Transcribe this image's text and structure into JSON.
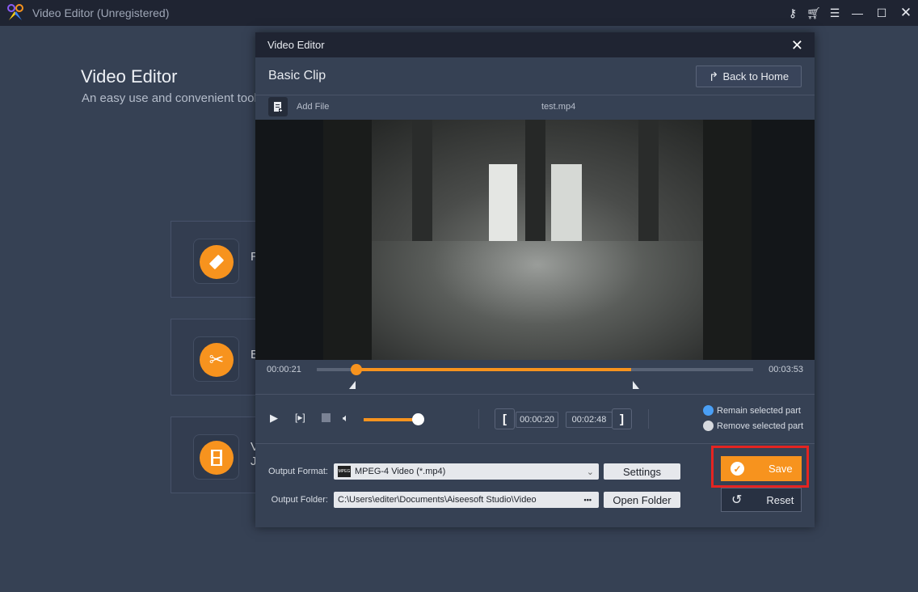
{
  "app": {
    "title": "Video Editor (Unregistered)"
  },
  "titlebar_icons": [
    "key-icon",
    "cart-icon",
    "menu-icon",
    "minimize-icon",
    "maximize-icon",
    "close-icon"
  ],
  "home": {
    "title": "Video Editor",
    "subtitle": "An easy use and convenient tool",
    "features": [
      {
        "icon": "rotate-icon",
        "label_partial": "R"
      },
      {
        "icon": "scissors-icon",
        "label_partial": "E"
      },
      {
        "icon": "film-icon",
        "label_partial_line1": "V",
        "label_partial_line2": "J"
      }
    ]
  },
  "dialog": {
    "title": "Video Editor",
    "heading": "Basic Clip",
    "back_button": "Back to Home",
    "add_file": "Add File",
    "filename": "test.mp4",
    "timeline": {
      "current_time": "00:00:21",
      "total_time": "00:03:53",
      "playhead_fraction": 0.09,
      "selection_end_fraction": 0.72
    },
    "controls": {
      "volume_fraction": 1.0,
      "start_time": "00:00:20",
      "end_time": "00:02:48",
      "start_bracket": "[",
      "end_bracket": "]"
    },
    "mode_options": [
      {
        "label": "Remain selected part",
        "selected": true
      },
      {
        "label": "Remove selected part",
        "selected": false
      }
    ],
    "output_format_label": "Output Format:",
    "output_format_value": "MPEG-4 Video (*.mp4)",
    "settings_button": "Settings",
    "output_folder_label": "Output Folder:",
    "output_folder_value": "C:\\Users\\editer\\Documents\\Aiseesoft Studio\\Video",
    "browse_glyph": "•••",
    "open_folder_button": "Open Folder",
    "save_button": "Save",
    "reset_button": "Reset"
  },
  "colors": {
    "accent": "#f7931e",
    "highlight": "#e52421",
    "radio_on": "#4a9ff5"
  }
}
